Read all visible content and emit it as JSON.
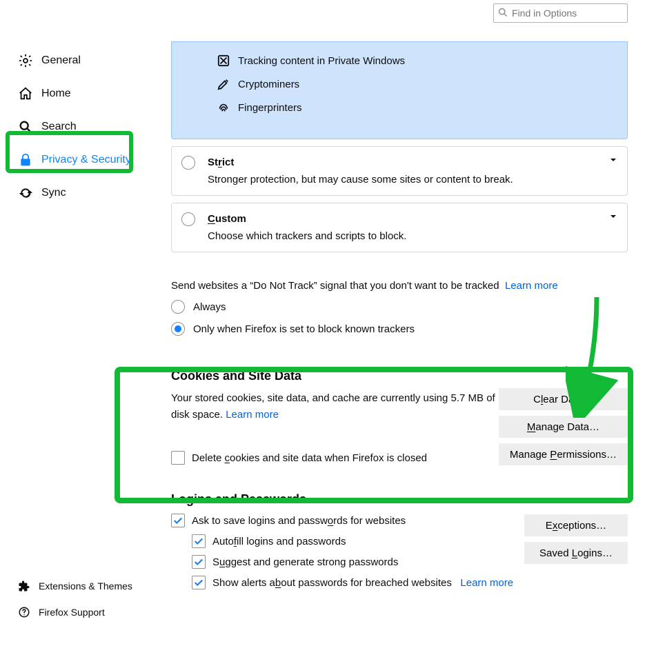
{
  "search": {
    "placeholder": "Find in Options"
  },
  "sidebar": {
    "items": [
      {
        "label": "General"
      },
      {
        "label": "Home"
      },
      {
        "label": "Search"
      },
      {
        "label": "Privacy & Security"
      },
      {
        "label": "Sync"
      }
    ]
  },
  "sidebar_bottom": {
    "extensions": "Extensions & Themes",
    "support": "Firefox Support"
  },
  "protection": {
    "tracking": "Tracking content in Private Windows",
    "cryptominers": "Cryptominers",
    "fingerprinters": "Fingerprinters"
  },
  "strict": {
    "title_pre": "St",
    "title_u": "r",
    "title_post": "ict",
    "desc": "Stronger protection, but may cause some sites or content to break."
  },
  "custom": {
    "title_pre": "",
    "title_u": "C",
    "title_post": "ustom",
    "desc": "Choose which trackers and scripts to block."
  },
  "dnt": {
    "label": "Send websites a “Do Not Track” signal that you don't want to be tracked",
    "learn": "Learn more",
    "always": "Always",
    "only": "Only when Firefox is set to block known trackers"
  },
  "cookies": {
    "title": "Cookies and Site Data",
    "desc_pre": "Your stored cookies, site data, and cache are currently using ",
    "desc_size": "5.7 MB",
    "desc_post": " of disk space.   ",
    "learn": "Learn more",
    "delete_pre": "Delete ",
    "delete_u": "c",
    "delete_post": "ookies and site data when Firefox is closed",
    "clear_pre": "C",
    "clear_u": "l",
    "clear_post": "ear Data…",
    "manage_pre": "",
    "manage_u": "M",
    "manage_post": "anage Data…",
    "perm_pre": "Manage ",
    "perm_u": "P",
    "perm_post": "ermissions…"
  },
  "logins": {
    "title": "Logins and Passwords",
    "ask_pre": "Ask to save logins and passw",
    "ask_u": "o",
    "ask_post": "rds for websites",
    "autofill_pre": "Auto",
    "autofill_u": "f",
    "autofill_post": "ill logins and passwords",
    "suggest_pre": "S",
    "suggest_u": "u",
    "suggest_post": "ggest and generate strong passwords",
    "alerts_pre": "Show alerts a",
    "alerts_u": "b",
    "alerts_post": "out passwords for breached websites",
    "learn": "Learn more",
    "exc_pre": "E",
    "exc_u": "x",
    "exc_post": "ceptions…",
    "saved_pre": "Saved ",
    "saved_u": "L",
    "saved_post": "ogins…"
  },
  "annotation": {
    "arrow_color": "#12b934"
  }
}
